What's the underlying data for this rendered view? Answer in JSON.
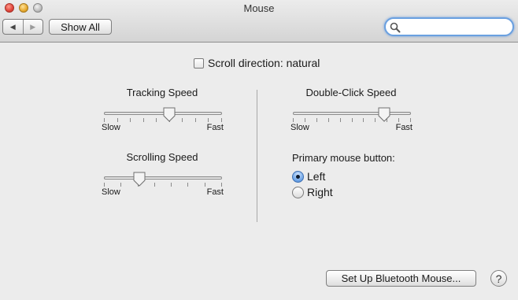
{
  "window": {
    "title": "Mouse",
    "show_all_label": "Show All",
    "back_glyph": "◀",
    "forward_glyph": "▶",
    "search_placeholder": "",
    "search_value": ""
  },
  "scroll_direction": {
    "label": "Scroll direction: natural",
    "checked": false
  },
  "tracking_speed": {
    "title": "Tracking Speed",
    "min_label": "Slow",
    "max_label": "Fast",
    "value": 0.55,
    "ticks": 10
  },
  "scrolling_speed": {
    "title": "Scrolling Speed",
    "min_label": "Slow",
    "max_label": "Fast",
    "value": 0.3,
    "ticks": 8
  },
  "double_click_speed": {
    "title": "Double-Click Speed",
    "min_label": "Slow",
    "max_label": "Fast",
    "value": 0.77,
    "ticks": 11
  },
  "primary_button": {
    "title": "Primary mouse button:",
    "options": [
      {
        "label": "Left",
        "checked": true
      },
      {
        "label": "Right",
        "checked": false
      }
    ]
  },
  "footer": {
    "bluetooth_button_label": "Set Up Bluetooth Mouse...",
    "help_label": "?"
  },
  "icons": {
    "search": "search-icon",
    "back": "back-arrow-icon",
    "forward": "forward-arrow-icon"
  }
}
